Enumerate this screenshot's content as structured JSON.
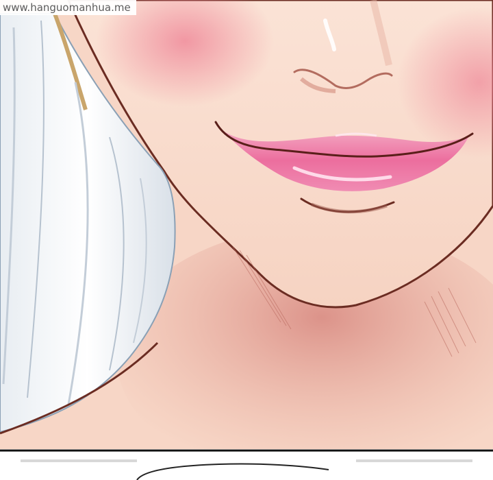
{
  "watermark": {
    "text": "www.hanguomanhua.me"
  },
  "illustration": {
    "palette": {
      "skin_light": "#fbe6d8",
      "skin_mid": "#f5c9b6",
      "skin_shadow": "#dc8f86",
      "blush": "#f28a9c",
      "lip_pink": "#ef6f9f",
      "lip_highlight": "#ffe4ef",
      "outline": "#6b2c22",
      "hair_white": "#f7f9fb",
      "hair_shade": "#cfd6df"
    }
  }
}
